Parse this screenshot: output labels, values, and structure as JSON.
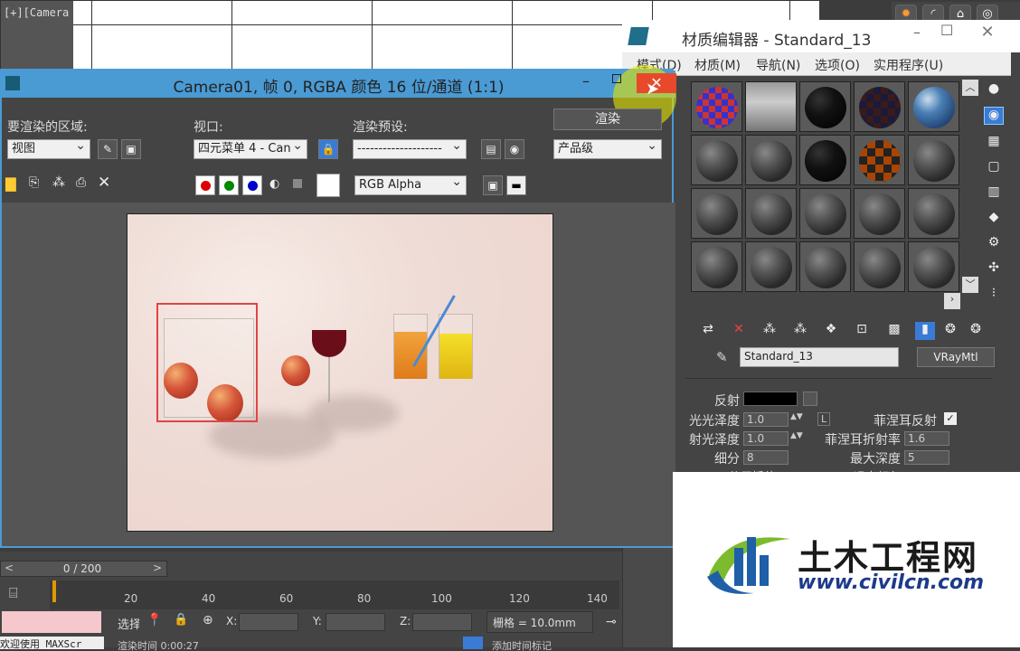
{
  "viewport": {
    "label": "[+][Camera"
  },
  "material_editor": {
    "title": "材质编辑器 - Standard_13",
    "menu": [
      "模式(D)",
      "材质(M)",
      "导航(N)",
      "选项(O)",
      "实用程序(U)"
    ],
    "material_name": "Standard_13",
    "material_type": "VRayMtl",
    "params": {
      "reflect_label": "反射",
      "gloss_label": "光光泽度",
      "gloss_value": "1.0",
      "l_label": "L",
      "fresnel_label": "菲涅耳反射",
      "refr_gloss_label": "射光泽度",
      "refr_gloss_value": "1.0",
      "fresnel_ior_label": "菲涅耳折射率",
      "fresnel_ior_value": "1.6",
      "subdiv_label": "细分",
      "subdiv_value": "8",
      "max_depth_label": "最大深度",
      "max_depth_value": "5",
      "interp_label": "使用插值",
      "exit_color_label": "退出颜色"
    }
  },
  "frame_window": {
    "title": "Camera01, 帧 0, RGBA 颜色 16 位/通道 (1:1)",
    "area_label": "要渲染的区域:",
    "area_value": "视图",
    "viewport_label": "视口:",
    "viewport_value": "四元菜单 4 - Can",
    "preset_label": "渲染预设:",
    "preset_value": "--------------------",
    "render_button": "渲染",
    "quality_value": "产品级",
    "channel_value": "RGB Alpha"
  },
  "timeline": {
    "slider_text": "0 / 200",
    "ticks": [
      "20",
      "40",
      "60",
      "80",
      "100",
      "120",
      "140"
    ],
    "grid_text": "栅格 = 10.0mm",
    "welcome": "欢迎使用 MAXScr",
    "select_label": "选择",
    "x_label": "X:",
    "y_label": "Y:",
    "z_label": "Z:",
    "bottom_text": "渲染时间 0:00:27",
    "add_time_tag": "添加时间标记"
  },
  "watermark": {
    "name": "土木工程网",
    "url": "www.civilcn.com"
  },
  "colors": {
    "titlebar": "#4a9ad4",
    "close": "#e8492b",
    "selection": "#e04444"
  }
}
